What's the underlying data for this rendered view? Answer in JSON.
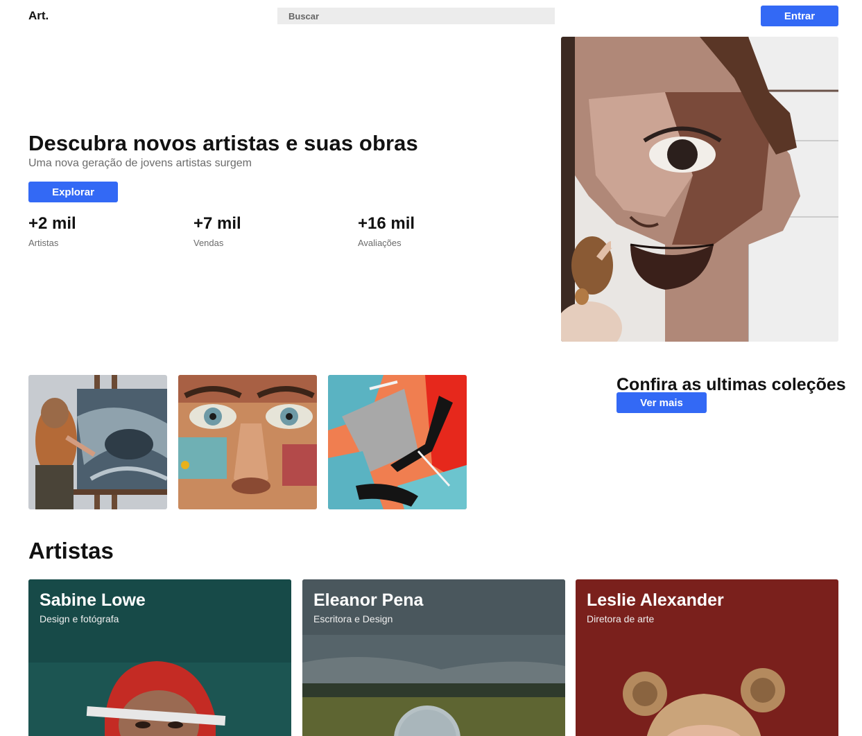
{
  "header": {
    "logo": "Art.",
    "search_placeholder": "Buscar",
    "login_label": "Entrar"
  },
  "hero": {
    "title": "Descubra novos artistas e suas obras",
    "subtitle": "Uma nova geração de jovens artistas surgem",
    "explore_label": "Explorar",
    "stats": [
      {
        "value": "+2 mil",
        "label": "Artistas"
      },
      {
        "value": "+7 mil",
        "label": "Vendas"
      },
      {
        "value": "+16 mil",
        "label": "Avaliações"
      }
    ]
  },
  "collections": {
    "title": "Confira as ultimas coleções",
    "more_label": "Ver mais"
  },
  "artists": {
    "title": "Artistas",
    "cards": [
      {
        "name": "Sabine Lowe",
        "role": "Design e fotógrafa",
        "bg_color": "#1c5552"
      },
      {
        "name": "Eleanor Pena",
        "role": "Escritora e Design",
        "bg_color": "#4f5c60"
      },
      {
        "name": "Leslie Alexander",
        "role": "Diretora de arte",
        "bg_color": "#7a201c"
      }
    ]
  },
  "colors": {
    "accent": "#3369f5",
    "text": "#111111",
    "muted": "#6b6b6b",
    "search_bg": "#ececec"
  }
}
